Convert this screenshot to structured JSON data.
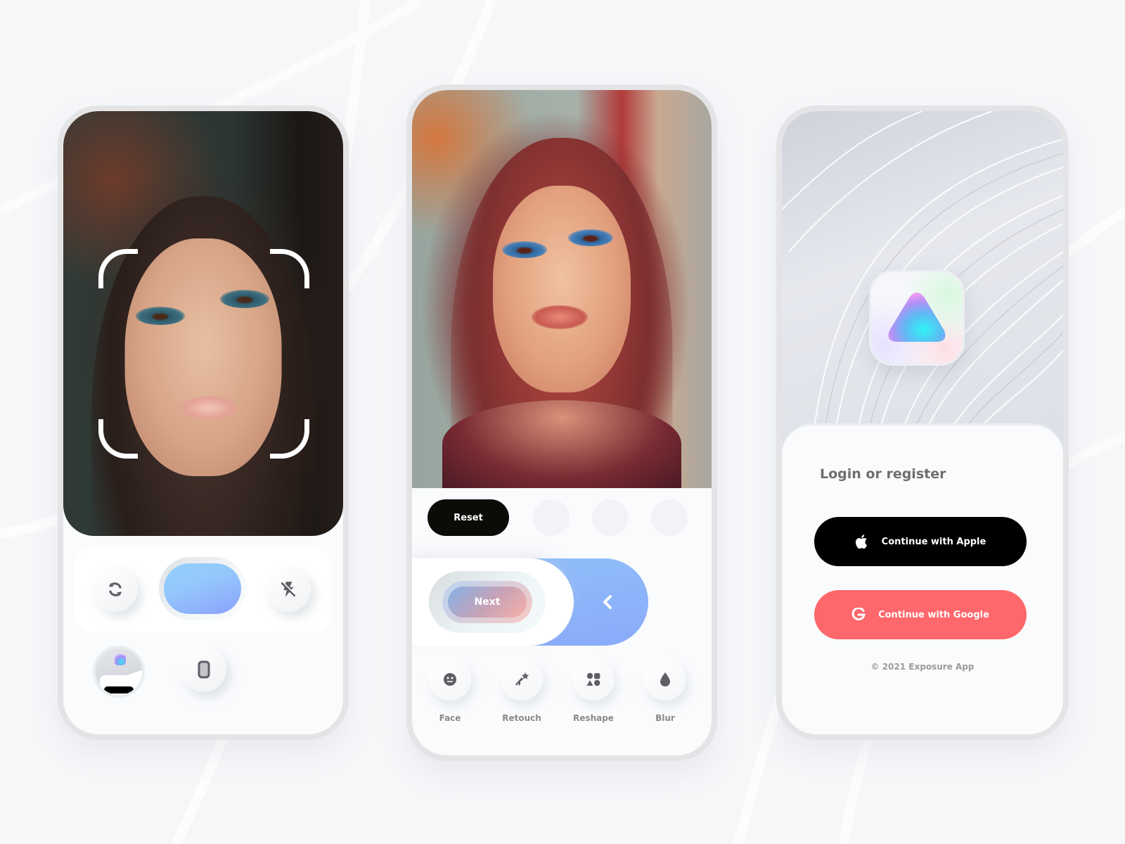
{
  "colors": {
    "background": "#f6f7f9",
    "shutter_gradient": [
      "#94cffd",
      "#8aa2fb"
    ],
    "reset_bg": "#0b0b08",
    "toggle_track": "#8aaaf9",
    "apple_bg": "#000000",
    "google_bg": "#fe676b",
    "icon_gray": "#5f5d66",
    "label_gray": "#8a8a8a"
  },
  "camera_screen": {
    "photo_alt": "Portrait of woman with blue eyeshadow",
    "face_scan_frame": "face-scan-brackets",
    "controls": {
      "switch_camera_icon": "refresh-icon",
      "shutter_label": "",
      "flash_icon": "flash-off-icon",
      "gallery_thumbnail": "last-photo-thumbnail",
      "aspect_icon": "phone-portrait-icon"
    }
  },
  "editor_screen": {
    "photo_alt": "Artistic painted filter portrait",
    "reset_label": "Reset",
    "presets": [
      "",
      "",
      ""
    ],
    "next_label": "Next",
    "back_icon": "chevron-left-icon",
    "tools": [
      {
        "label": "Face",
        "icon": "face-icon"
      },
      {
        "label": "Retouch",
        "icon": "shooting-star-icon"
      },
      {
        "label": "Reshape",
        "icon": "shapes-icon"
      },
      {
        "label": "Blur",
        "icon": "drop-icon"
      }
    ]
  },
  "login_screen": {
    "app_icon": "exposure-triangle-logo",
    "title": "Login or register",
    "apple_label": "Continue with Apple",
    "google_label": "Continue with Google",
    "copyright": "© 2021 Exposure App"
  }
}
